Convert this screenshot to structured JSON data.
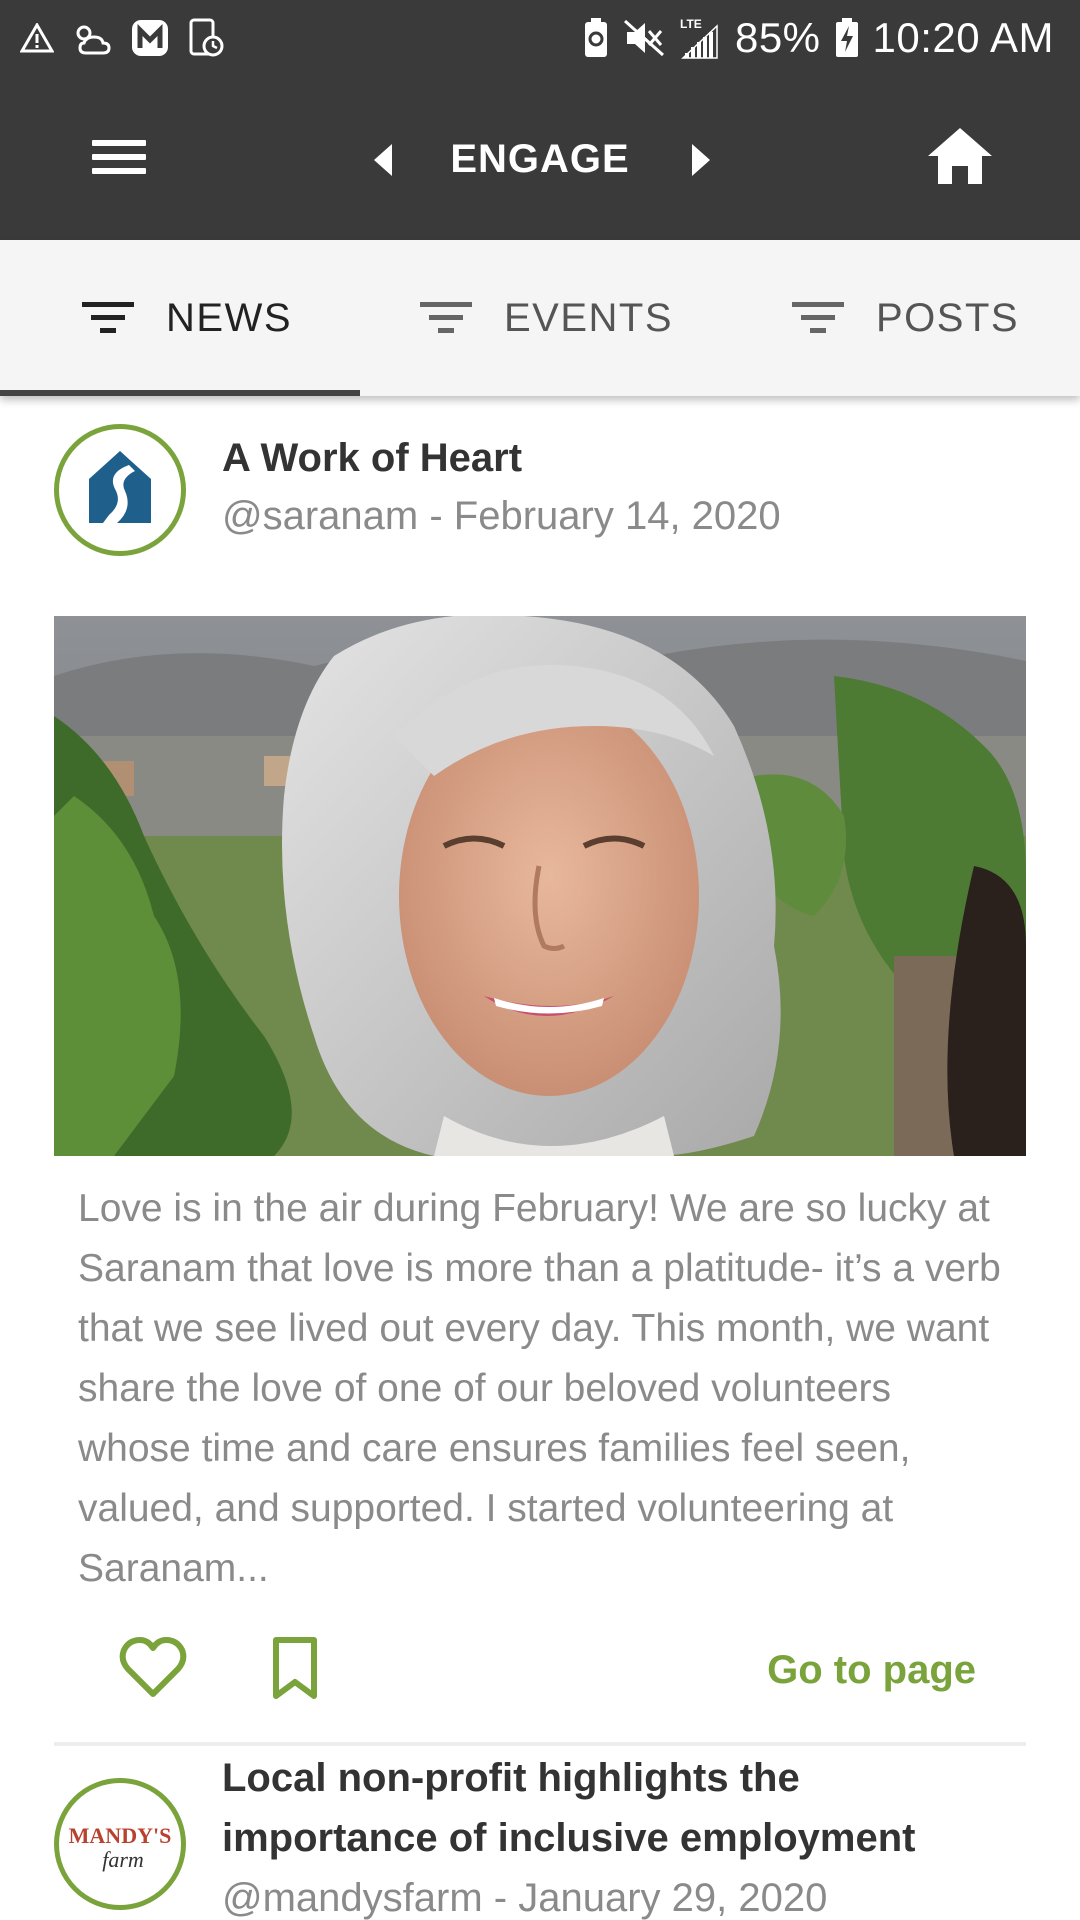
{
  "status_bar": {
    "battery": "85%",
    "time": "10:20 AM",
    "network": "LTE"
  },
  "app_bar": {
    "title": "ENGAGE"
  },
  "tabs": [
    {
      "label": "NEWS",
      "active": true
    },
    {
      "label": "EVENTS",
      "active": false
    },
    {
      "label": "POSTS",
      "active": false
    }
  ],
  "posts": [
    {
      "title": "A Work of Heart",
      "meta": "@saranam - February 14, 2020",
      "body": "Love is in the air during February! We are so lucky at Saranam that love is more than a platitude- it’s a verb that we see lived out every day. This month, we want share the love of one of our beloved volunteers whose time and care ensures families feel seen, valued, and supported. I started volunteering at Saranam...",
      "goto_label": "Go to page",
      "avatar_icon": "saranam-logo"
    },
    {
      "title": "Local non-profit highlights the importance of inclusive employment",
      "meta": "@mandysfarm - January 29, 2020",
      "avatar_text_top": "MANDY'S",
      "avatar_text_bottom": "farm"
    }
  ],
  "colors": {
    "bar": "#3a3a3a",
    "accent_green": "#7aa33c",
    "tab_bg": "#f5f5f5"
  }
}
